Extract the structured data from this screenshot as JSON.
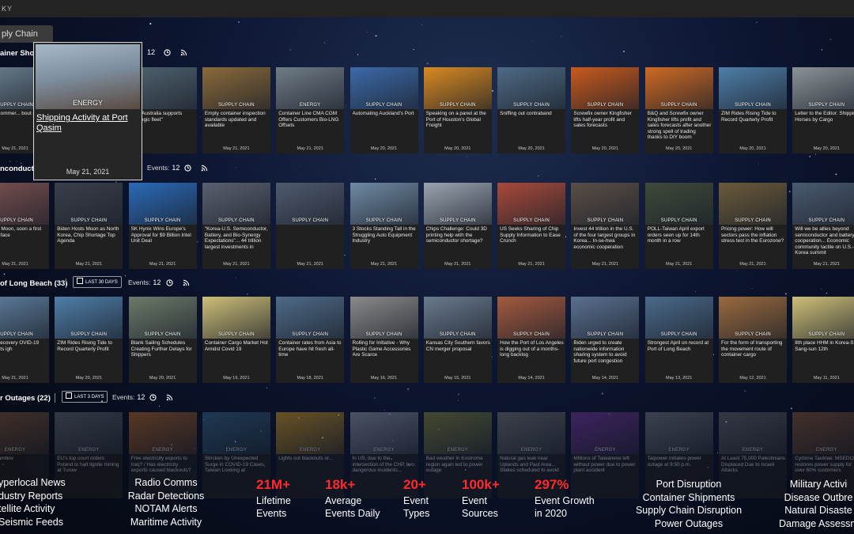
{
  "app": {
    "title": "KY"
  },
  "active_tab": {
    "label": "ply Chain"
  },
  "sections": [
    {
      "title": "ainer Short",
      "range_label": "",
      "events_label": "",
      "events_count": "12",
      "cards": [
        {
          "category": "SUPPLY CHAIN",
          "title": "ew of Commer... bout supply es",
          "date": "May 21, 2021",
          "thumb": "#6a7f8e"
        },
        {
          "category": "SUPPLY CHAIN",
          "title": "",
          "date": "",
          "thumb": "#5c6f82"
        },
        {
          "category": "",
          "title": "ping Australia supports strategic fleet\"",
          "date": "",
          "thumb": "#4f6270"
        },
        {
          "category": "SUPPLY CHAIN",
          "title": "Empty container inspection standards updated and available",
          "date": "May 21, 2021",
          "thumb": "#8a6a3a"
        },
        {
          "category": "ENERGY",
          "title": "Container Line CMA CGM Offers Customers Bio-LNG Offsets",
          "date": "May 21, 2021",
          "thumb": "#6f7c86"
        },
        {
          "category": "SUPPLY CHAIN",
          "title": "Automating Auckland's Port",
          "date": "May 20, 2021",
          "thumb": "#3c6aa8"
        },
        {
          "category": "SUPPLY CHAIN",
          "title": "Speaking on a panel at the Port of Houston's Global Freight",
          "date": "May 20, 2021",
          "thumb": "#d98a22"
        },
        {
          "category": "SUPPLY CHAIN",
          "title": "Sniffing out contraband",
          "date": "May 20, 2021",
          "thumb": "#4e6a85"
        },
        {
          "category": "SUPPLY CHAIN",
          "title": "Screwfix owner Kingfisher lifts half-year profit and sales forecasts",
          "date": "May 20, 2021",
          "thumb": "#c85a1e"
        },
        {
          "category": "SUPPLY CHAIN",
          "title": "B&Q and Screwfix owner Kingfisher lifts profit and sales forecasts after another strong spell of trading thanks to DIY boom",
          "date": "May 20, 2021",
          "thumb": "#cf6a24"
        },
        {
          "category": "SUPPLY CHAIN",
          "title": "ZIM Rides Rising Tide to Record Quarterly Profit",
          "date": "May 20, 2021",
          "thumb": "#4f7ea8"
        },
        {
          "category": "SUPPLY CHAIN",
          "title": "Letter to the Editor: Shipping Horses by Cargo",
          "date": "May 20, 2021",
          "thumb": "#8c9398"
        }
      ]
    },
    {
      "title": "nconductor",
      "range_label": "",
      "events_label": "Events:",
      "events_count": "12",
      "cards": [
        {
          "category": "SUPPLY CHAIN",
          "title": "ational] Moon, soon a first face-to-face",
          "date": "May 21, 2021",
          "thumb": "#7a5050"
        },
        {
          "category": "SUPPLY CHAIN",
          "title": "Biden Hosts Moon as North Korea, Chip Shortage Top Agenda",
          "date": "May 21, 2021",
          "thumb": "#3a3f4a"
        },
        {
          "category": "SUPPLY CHAIN",
          "title": "SK Hynix Wins Europe's Approval for $9 Billion Intel Unit Deal",
          "date": "May 21, 2021",
          "thumb": "#2a6ab8"
        },
        {
          "category": "SUPPLY CHAIN",
          "title": "\"Korea-U.S. Semiconductor, Battery, and Bio-Synergy Expectations\"... 44 trillion largest investments in",
          "date": "May 21, 2021",
          "thumb": "#5a6070"
        },
        {
          "category": "SUPPLY CHAIN",
          "title": "",
          "date": "May 21, 2021",
          "thumb": "#4e5a6e"
        },
        {
          "category": "SUPPLY CHAIN",
          "title": "3 Stocks Standing Tall in the Struggling Auto Equipment Industry",
          "date": "May 21, 2021",
          "thumb": "#6f8aa4"
        },
        {
          "category": "SUPPLY CHAIN",
          "title": "Chips Challenge: Could 3D printing help with the semiconductor shortage?",
          "date": "May 21, 2021",
          "thumb": "#9aa4b0"
        },
        {
          "category": "SUPPLY CHAIN",
          "title": "US Seeks Sharing of Chip Supply Information to Ease Crunch",
          "date": "May 21, 2021",
          "thumb": "#a84a3a"
        },
        {
          "category": "SUPPLY CHAIN",
          "title": "Invest 44 trillion in the U.S. of the four largest groups in Korea... In-se-hwa economic cooperation",
          "date": "May 21, 2021",
          "thumb": "#5a4e46"
        },
        {
          "category": "SUPPLY CHAIN",
          "title": "POLL-Taiwan April export orders seen up for 14th month in a row",
          "date": "May 21, 2021",
          "thumb": "#3e4a3a"
        },
        {
          "category": "SUPPLY CHAIN",
          "title": "Pricing power: How will sectors pass the inflation stress test in the Eurozone?",
          "date": "May 21, 2021",
          "thumb": "#6a5a3a"
        },
        {
          "category": "SUPPLY CHAIN",
          "title": "Will we be allies beyond semiconductor and battery cooperation... Economic community tactile on U.S.-Korea summit",
          "date": "May 21, 2021",
          "thumb": "#4a5a70"
        },
        {
          "category": "SUPPLY CHAIN",
          "title": "SK Hynix Wins Europe's Approval for $9 Billion Inte Unit Deal",
          "date": "May 21, 2021",
          "thumb": "#b84830"
        }
      ]
    },
    {
      "title": "of Long Beach (33)",
      "range_label": "LAST 30 DAYS",
      "events_label": "Events:",
      "events_count": "12",
      "cards": [
        {
          "category": "SUPPLY CHAIN",
          "title": "rade's recovery OVID-19 crisis hits igh",
          "date": "May 21, 2021",
          "thumb": "#5e7f9e"
        },
        {
          "category": "SUPPLY CHAIN",
          "title": "ZIM Rides Rising Tide to Record Quarterly Profit",
          "date": "May 20, 2021",
          "thumb": "#4f7ea8"
        },
        {
          "category": "SUPPLY CHAIN",
          "title": "Blank Sailing Schedules Creating Further Delays for Shippers",
          "date": "May 20, 2021",
          "thumb": "#6c7a6a"
        },
        {
          "category": "SUPPLY CHAIN",
          "title": "Container Cargo Market Hot Amidst Covid 19",
          "date": "May 19, 2021",
          "thumb": "#cdbf78"
        },
        {
          "category": "SUPPLY CHAIN",
          "title": "Container rates from Asia to Europe have hit fresh all-time",
          "date": "May 18, 2021",
          "thumb": "#4e6a88"
        },
        {
          "category": "SUPPLY CHAIN",
          "title": "Rolling for Initiative - Why Plastic Game Accessories Are Scarce",
          "date": "May 16, 2021",
          "thumb": "#8a8a8a"
        },
        {
          "category": "SUPPLY CHAIN",
          "title": "Kansas City Southern favors CN merger proposal",
          "date": "May 15, 2021",
          "thumb": "#6a7a8e"
        },
        {
          "category": "SUPPLY CHAIN",
          "title": "How the Port of Los Angeles is digging out of a months-long backlog",
          "date": "May 14, 2021",
          "thumb": "#a45a3e"
        },
        {
          "category": "SUPPLY CHAIN",
          "title": "Biden urged to create nationwide information sharing system to avoid future port congestion",
          "date": "May 14, 2021",
          "thumb": "#5a7090"
        },
        {
          "category": "SUPPLY CHAIN",
          "title": "Strongest April on record at Port of Long Beach",
          "date": "May 13, 2021",
          "thumb": "#4a6a8a"
        },
        {
          "category": "SUPPLY CHAIN",
          "title": "For the form of transporting the movement route of container cargo",
          "date": "May 12, 2021",
          "thumb": "#9a6a3e"
        },
        {
          "category": "SUPPLY CHAIN",
          "title": "8th place HHM in Korea-SM Sang-sun 12th",
          "date": "May 11, 2021",
          "thumb": "#cdbf78"
        }
      ]
    },
    {
      "title": "r Outages (22)",
      "range_label": "LAST 3 DAYS",
      "events_label": "Events:",
      "events_count": "12",
      "cards": [
        {
          "category": "ENERGY",
          "title": "ed in Tambov",
          "date": "",
          "thumb": "#8a6040"
        },
        {
          "category": "ENERGY",
          "title": "EU's top court orders Poland to halt lignite mining at Turow",
          "date": "",
          "thumb": "#6a6e78"
        },
        {
          "category": "ENERGY",
          "title": "Free electricity exports to Iraq? / Has electricity exports caused blackouts?",
          "date": "",
          "thumb": "#b86a2a"
        },
        {
          "category": "ENERGY",
          "title": "Stricken by Unexpected Surge in COVID-19 Cases, Taiwan Looking at",
          "date": "",
          "thumb": "#3a6a8a"
        },
        {
          "category": "ENERGY",
          "title": "Lights out blackouts or...",
          "date": "",
          "thumb": "#d8a020"
        },
        {
          "category": "ENERGY",
          "title": "In US, due to the intersection of the CHP, two dangerous incidents...",
          "date": "",
          "thumb": "#9aa0a8"
        },
        {
          "category": "ENERGY",
          "title": "Bad weather in Kostroma region again led to power outage",
          "date": "",
          "thumb": "#8a8a3a"
        },
        {
          "category": "ENERGY",
          "title": "Natural gas leak near Uplands and Paul Area... Stakes scheduled to avoid",
          "date": "",
          "thumb": "#7a7a70"
        },
        {
          "category": "ENERGY",
          "title": "Millions of Taiwanese left without power due to power plant accident",
          "date": "",
          "thumb": "#7a3a9a"
        },
        {
          "category": "ENERGY",
          "title": "Taipower initiates power outage at 9:50 p.m.",
          "date": "",
          "thumb": "#7a7a80"
        },
        {
          "category": "ENERGY",
          "title": "At Least 75,000 Palestinians Displaced Due to Israeli Attacks",
          "date": "",
          "thumb": "#6a6a6a"
        },
        {
          "category": "ENERGY",
          "title": "Cyclone Tauktae: MSEDCL restores power supply for over 60% customers",
          "date": "",
          "thumb": "#8a5a3a"
        }
      ]
    }
  ],
  "popup": {
    "category": "ENERGY",
    "title": "Shipping Activity at Port Qasim",
    "date": "May 21, 2021",
    "thumb": "#7d8fa0"
  },
  "bottom": {
    "left_list": [
      "yperlocal News",
      "dustry Reports",
      "tellite Activity",
      "Seismic Feeds"
    ],
    "center_list": [
      "Radio Comms",
      "Radar Detections",
      "NOTAM Alerts",
      "Maritime Activity"
    ],
    "stats": [
      {
        "value": "21M+",
        "label1": "Lifetime",
        "label2": "Events"
      },
      {
        "value": "18k+",
        "label1": "Average",
        "label2": "Events Daily"
      },
      {
        "value": "20+",
        "label1": "Event",
        "label2": "Types"
      },
      {
        "value": "100k+",
        "label1": "Event",
        "label2": "Sources"
      },
      {
        "value": "297%",
        "label1": "Event Growth",
        "label2": "in 2020"
      }
    ],
    "right_list": [
      "Port Disruption",
      "Container Shipments",
      "Supply Chain Disruption",
      "Power Outages"
    ],
    "far_right_list": [
      "Military Activi",
      "Disease Outbre",
      "Natural Disaste",
      "Damage Assessm"
    ]
  },
  "colors": {
    "stat_red": "#ff2a2a",
    "card_bg": "#202020",
    "topbar": "#232323"
  }
}
